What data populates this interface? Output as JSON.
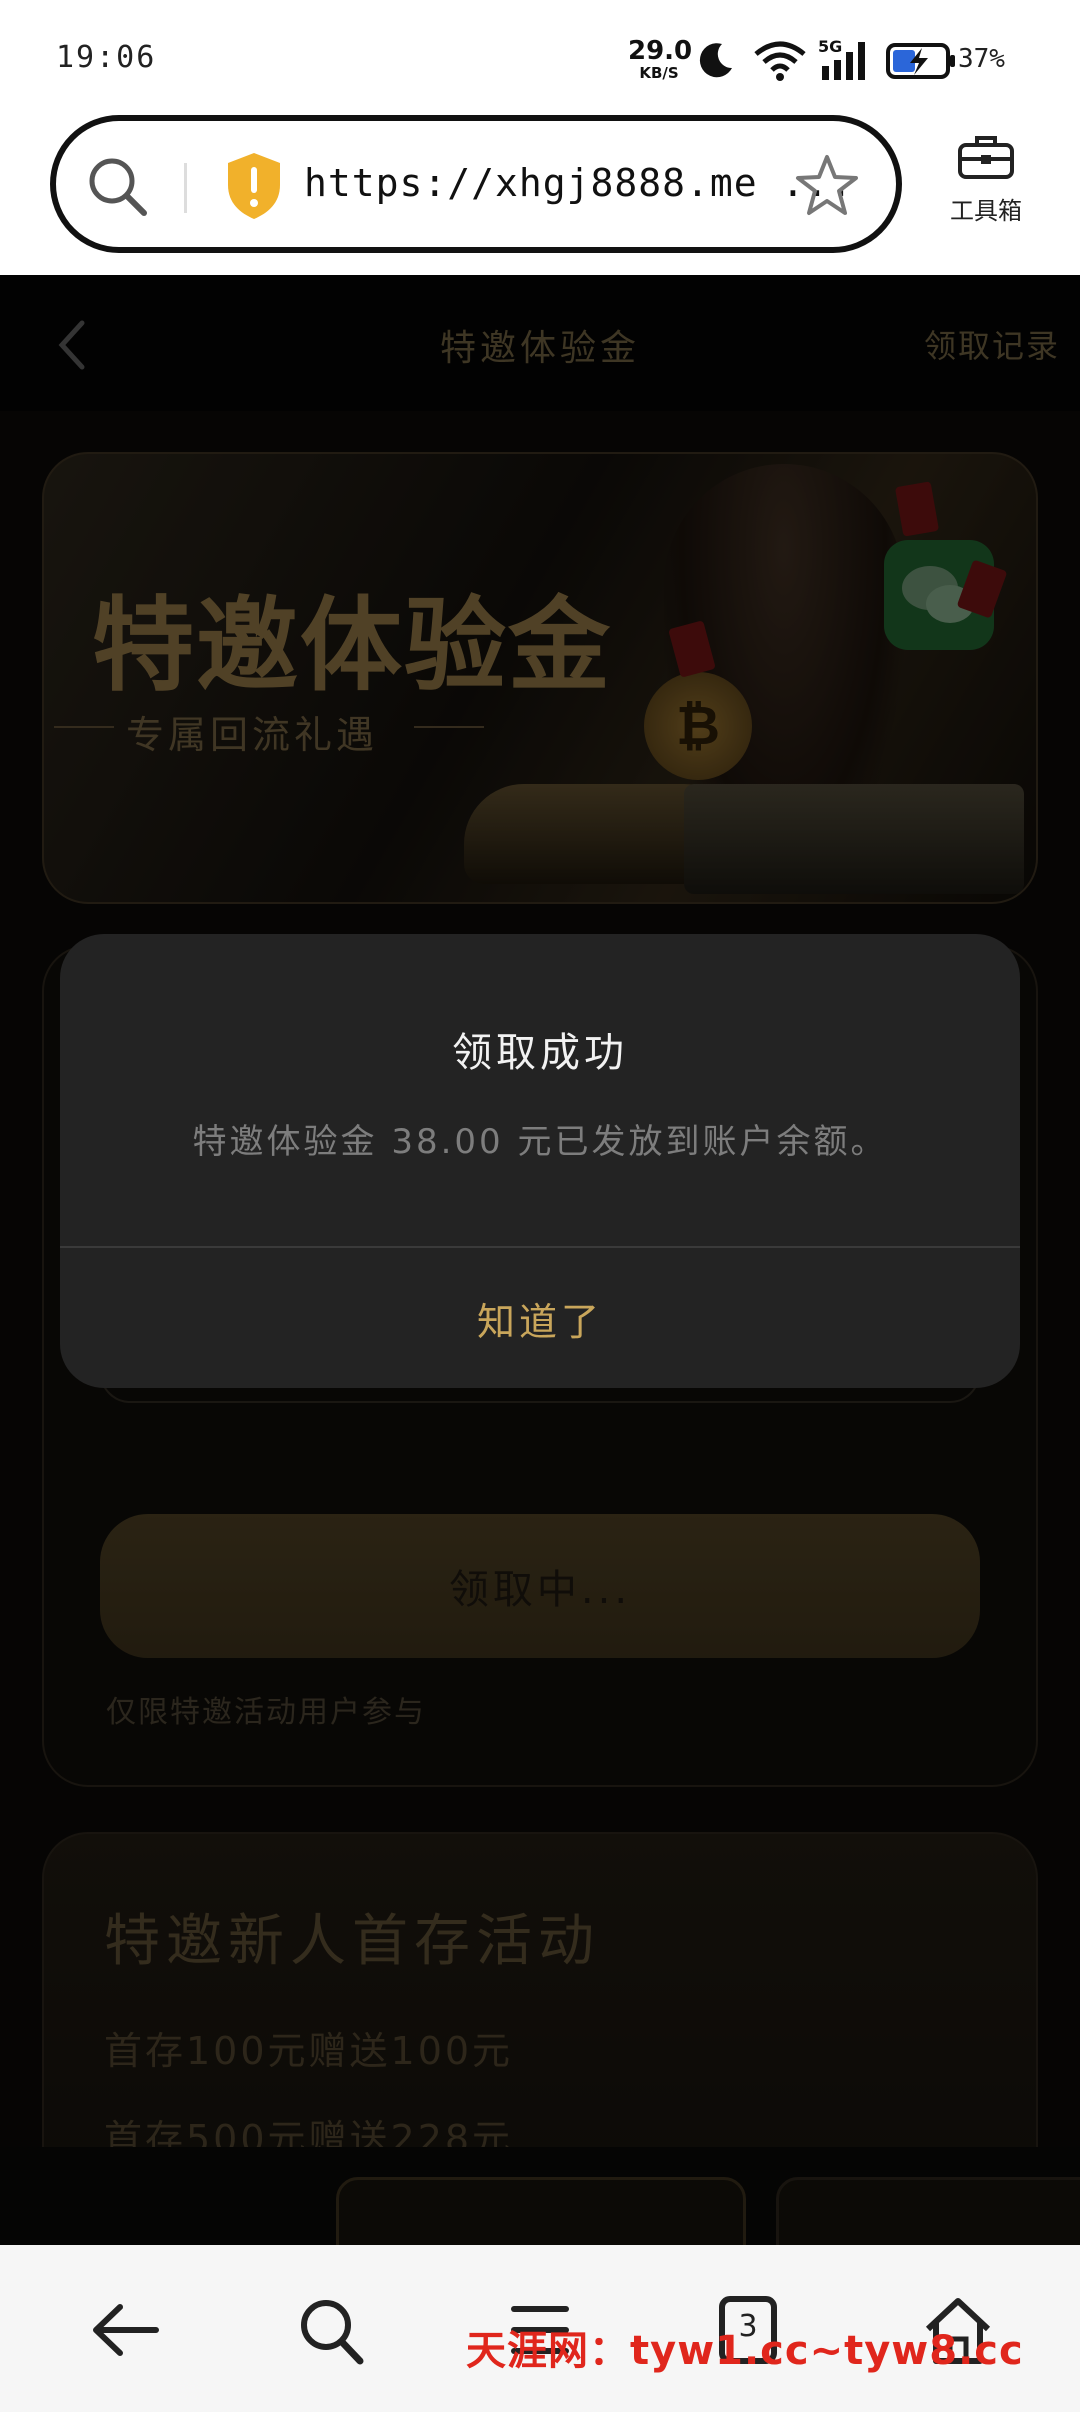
{
  "status_bar": {
    "time": "19:06",
    "net_speed_value": "29.0",
    "net_speed_unit": "KB/S",
    "battery_percent": "37%",
    "icons": [
      "moon-icon",
      "wifi-icon",
      "5g-signal-icon",
      "battery-charging-icon"
    ]
  },
  "browser": {
    "url": "https://xhgj8888.me ...",
    "toolbox_label": "工具箱",
    "icons": [
      "search-icon",
      "shield-warning-icon",
      "star-icon",
      "toolbox-icon"
    ]
  },
  "header": {
    "title": "特邀体验金",
    "records_link": "领取记录"
  },
  "banner": {
    "title": "特邀体验金",
    "subtitle": "专属回流礼遇",
    "coin_symbol": "₿"
  },
  "claim": {
    "button_label": "领取中...",
    "note": "仅限特邀活动用户参与"
  },
  "promo": {
    "title": "特邀新人首存活动",
    "items": [
      "首存100元赠送100元",
      "首存500元赠送228元"
    ]
  },
  "modal": {
    "title": "领取成功",
    "message": "特邀体验金 38.00 元已发放到账户余额。",
    "confirm_label": "知道了"
  },
  "nav": {
    "tab_count": "3",
    "icons": [
      "back-arrow-icon",
      "search-icon",
      "menu-icon",
      "tabs-icon",
      "home-icon"
    ]
  },
  "watermark": "天涯网：tyw1.cc~tyw8.cc",
  "colors": {
    "accent_gold": "#c9a65b",
    "watermark_red": "#e0261c",
    "modal_bg": "#232323"
  }
}
